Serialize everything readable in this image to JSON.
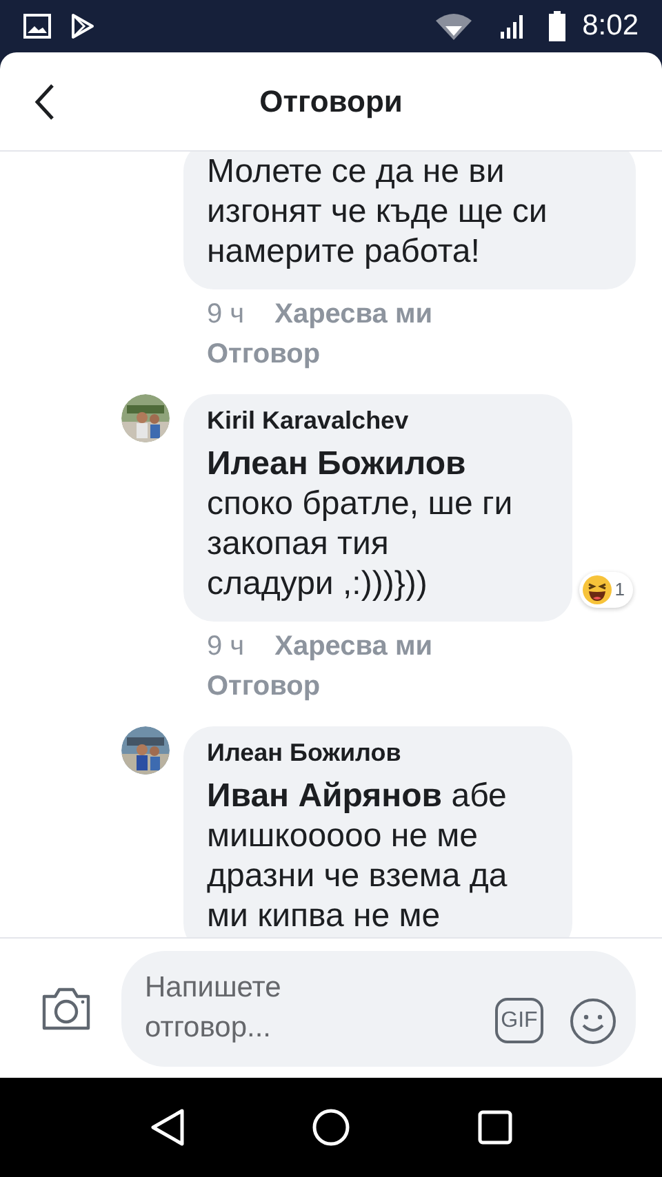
{
  "status_bar": {
    "time": "8:02"
  },
  "header": {
    "title": "Отговори"
  },
  "comments": [
    {
      "text": "Молете се да не ви изгонят че къде ще си намерите работа!",
      "time": "9 ч",
      "like": "Харесва ми",
      "reply": "Отговор"
    },
    {
      "author": "Kiril Karavalchev",
      "text": "**Илеан Божилов** споко братле, ше ги закопая тия\nсладури ,:)))}))",
      "reaction": {
        "count": "1"
      },
      "time": "9 ч",
      "like": "Харесва ми",
      "reply": "Отговор"
    },
    {
      "author": "Илеан Божилов",
      "text": "**Иван Айрянов** абе мишкооооо не ме дразни че взема да ми кипва не ме"
    }
  ],
  "composer": {
    "placeholder": "Напишете отговор...",
    "gif_label": "GIF"
  }
}
